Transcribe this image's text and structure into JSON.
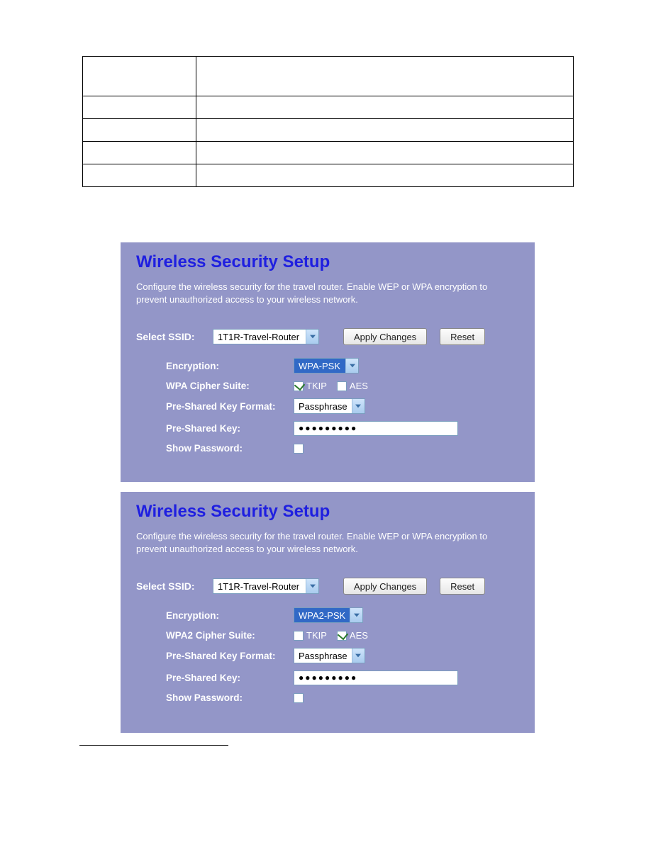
{
  "table": {
    "rows": [
      {
        "c1": "",
        "c2": ""
      },
      {
        "c1": "",
        "c2": ""
      },
      {
        "c1": "",
        "c2": ""
      },
      {
        "c1": "",
        "c2": ""
      },
      {
        "c1": "",
        "c2": ""
      }
    ]
  },
  "heading": "Wireless Security Setup",
  "description": "Configure the wireless security for the travel router. Enable WEP or WPA encryption to prevent unauthorized access to your wireless network.",
  "select_ssid_label": "Select SSID:",
  "ssid_value": "1T1R-Travel-Router",
  "apply_label": "Apply Changes",
  "reset_label": "Reset",
  "panel1": {
    "encryption_label": "Encryption:",
    "encryption_value": "WPA-PSK",
    "cipher_label": "WPA Cipher Suite:",
    "tkip_label": "TKIP",
    "aes_label": "AES",
    "tkip_checked": true,
    "aes_checked": false,
    "pskf_label": "Pre-Shared Key Format:",
    "pskf_value": "Passphrase",
    "psk_label": "Pre-Shared Key:",
    "psk_value": "●●●●●●●●●",
    "showpw_label": "Show Password:",
    "showpw_checked": false
  },
  "panel2": {
    "encryption_label": "Encryption:",
    "encryption_value": "WPA2-PSK",
    "cipher_label": "WPA2 Cipher Suite:",
    "tkip_label": "TKIP",
    "aes_label": "AES",
    "tkip_checked": false,
    "aes_checked": true,
    "pskf_label": "Pre-Shared Key Format:",
    "pskf_value": "Passphrase",
    "psk_label": "Pre-Shared Key:",
    "psk_value": "●●●●●●●●●",
    "showpw_label": "Show Password:",
    "showpw_checked": false
  }
}
